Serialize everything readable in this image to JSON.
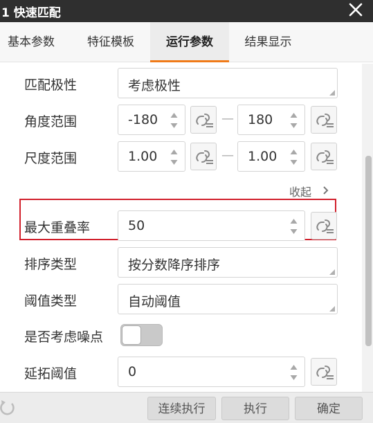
{
  "window": {
    "title": "1 快速匹配",
    "close_icon": "close-icon"
  },
  "tabs": [
    {
      "label": "基本参数",
      "active": false
    },
    {
      "label": "特征模板",
      "active": false
    },
    {
      "label": "运行参数",
      "active": true
    },
    {
      "label": "结果显示",
      "active": false
    }
  ],
  "params": {
    "match_polarity": {
      "label": "匹配极性",
      "value": "考虑极性"
    },
    "angle_range": {
      "label": "角度范围",
      "min": "-180",
      "max": "180",
      "separator": "—"
    },
    "scale_range": {
      "label": "尺度范围",
      "min": "1.00",
      "max": "1.00",
      "separator": "—"
    },
    "collapse_label": "收起",
    "max_overlap": {
      "label": "最大重叠率",
      "value": "50",
      "highlighted": true
    },
    "sort_type": {
      "label": "排序类型",
      "value": "按分数降序排序"
    },
    "threshold_type": {
      "label": "阈值类型",
      "value": "自动阈值"
    },
    "consider_noise": {
      "label": "是否考虑噪点",
      "enabled": false
    },
    "extend_threshold": {
      "label": "延拓阈值",
      "value": "0"
    }
  },
  "footer": {
    "continuous_label": "连续执行",
    "execute_label": "执行",
    "confirm_label": "确定"
  },
  "colors": {
    "accent": "#f07a18",
    "highlight_border": "#d11f2b",
    "titlebar": "#2f2f2f"
  }
}
